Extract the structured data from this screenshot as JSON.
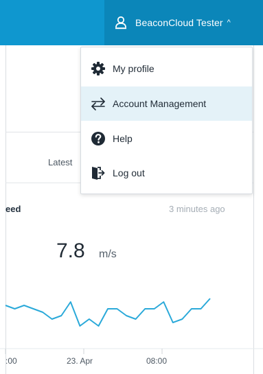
{
  "header": {
    "user_name": "BeaconCloud Tester",
    "caret": "^",
    "user_icon": "user-icon",
    "bar_color": "#0f97cf",
    "trigger_color": "#0b86b9"
  },
  "user_menu": {
    "items": [
      {
        "label": "My profile",
        "icon": "gear-icon"
      },
      {
        "label": "Account Management",
        "icon": "swap-arrows-icon"
      },
      {
        "label": "Help",
        "icon": "question-circle-icon"
      },
      {
        "label": "Log out",
        "icon": "logout-door-icon"
      }
    ],
    "active_item": "Account Management",
    "active_color": "#e4f2f8"
  },
  "background": {
    "latest_label": "Latest",
    "card": {
      "title": "eed",
      "updated": "3 minutes ago",
      "value": "7.8",
      "unit": "m/s"
    }
  },
  "chart_data": {
    "type": "line",
    "x_ticks": [
      ":00",
      "23. Apr",
      "08:00"
    ],
    "series": [
      {
        "values": [
          7.4,
          7.3,
          7.4,
          7.3,
          7.2,
          7.0,
          7.1,
          7.5,
          6.8,
          7.0,
          6.8,
          7.3,
          7.3,
          7.1,
          7.0,
          7.3,
          7.3,
          7.5,
          6.9,
          7.0,
          7.3,
          7.3,
          7.6
        ]
      }
    ],
    "line_color": "#2aa9d9"
  }
}
